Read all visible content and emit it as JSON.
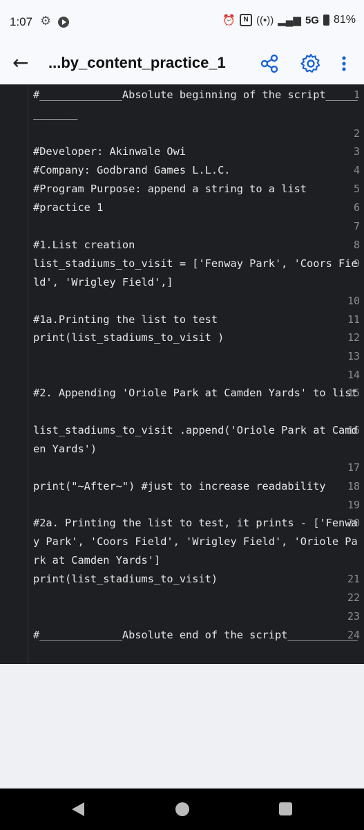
{
  "status_bar": {
    "time": "1:07",
    "network": "5G",
    "battery": "81%"
  },
  "app_bar": {
    "title": "...by_content_practice_1",
    "icons": [
      "back-arrow-icon",
      "share-icon",
      "settings-icon",
      "more-vert-icon"
    ]
  },
  "editor": {
    "lines": [
      {
        "n": "1",
        "text": "#_____________Absolute beginning of the script____________"
      },
      {
        "n": "2",
        "text": ""
      },
      {
        "n": "3",
        "text": "#Developer: Akinwale Owi"
      },
      {
        "n": "4",
        "text": "#Company: Godbrand Games L.L.C."
      },
      {
        "n": "5",
        "text": "#Program Purpose: append a string to a list"
      },
      {
        "n": "6",
        "text": "#practice 1"
      },
      {
        "n": "7",
        "text": ""
      },
      {
        "n": "8",
        "text": "#1.List creation"
      },
      {
        "n": "9",
        "text": "list_stadiums_to_visit = ['Fenway Park', 'Coors Field', 'Wrigley Field',]"
      },
      {
        "n": "10",
        "text": ""
      },
      {
        "n": "11",
        "text": "#1a.Printing the list to test"
      },
      {
        "n": "12",
        "text": "print(list_stadiums_to_visit )"
      },
      {
        "n": "13",
        "text": ""
      },
      {
        "n": "14",
        "text": ""
      },
      {
        "n": "15",
        "text": "#2. Appending 'Oriole Park at Camden Yards' to list"
      },
      {
        "n": "16",
        "text": "list_stadiums_to_visit .append('Oriole Park at Camden Yards')"
      },
      {
        "n": "17",
        "text": ""
      },
      {
        "n": "18",
        "text": "print(\"~After~\") #just to increase readability"
      },
      {
        "n": "19",
        "text": ""
      },
      {
        "n": "20",
        "text": "#2a. Printing the list to test, it prints - ['Fenway Park', 'Coors Field', 'Wrigley Field', 'Oriole Park at Camden Yards']"
      },
      {
        "n": "21",
        "text": "print(list_stadiums_to_visit)"
      },
      {
        "n": "22",
        "text": ""
      },
      {
        "n": "23",
        "text": ""
      },
      {
        "n": "24",
        "text": "#_____________Absolute end of the script___________"
      }
    ]
  },
  "colors": {
    "editor_bg": "#1e1f23",
    "accent": "#1a63d6"
  }
}
